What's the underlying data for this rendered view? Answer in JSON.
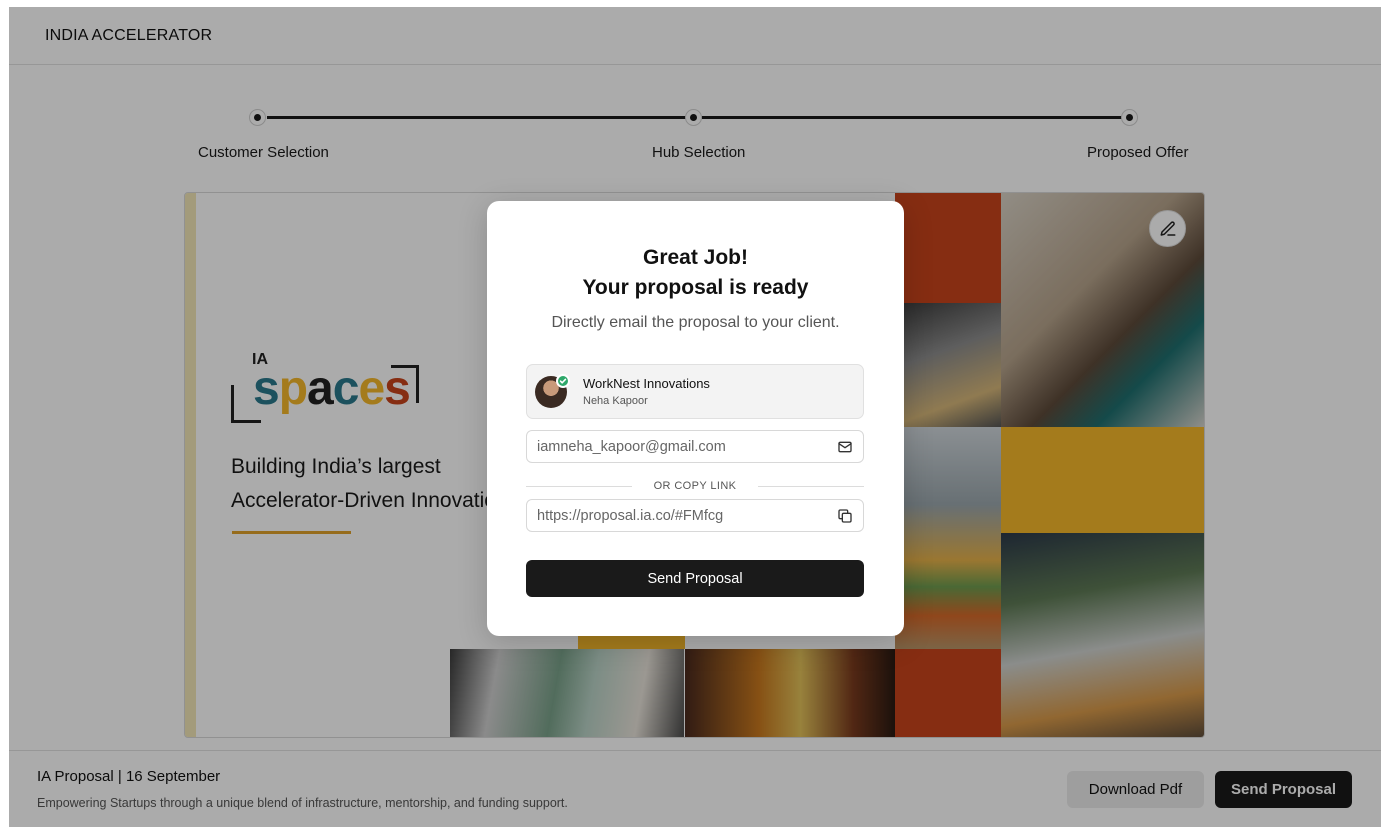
{
  "header": {
    "brand": "INDIA ACCELERATOR"
  },
  "stepper": {
    "steps": [
      {
        "label": "Customer Selection"
      },
      {
        "label": "Hub Selection"
      },
      {
        "label": "Proposed Offer"
      }
    ]
  },
  "preview": {
    "logo_prefix": "IA",
    "logo_word": "spaces",
    "headline_line1": "Building India’s largest",
    "headline_line2": "Accelerator-Driven Innovation"
  },
  "modal": {
    "title_line1": "Great Job!",
    "title_line2": "Your proposal is ready",
    "subtitle": "Directly email the proposal to your client.",
    "client": {
      "company": "WorkNest Innovations",
      "contact": "Neha Kapoor"
    },
    "email_value": "iamneha_kapoor@gmail.com",
    "divider_text": "OR COPY LINK",
    "link_value": "https://proposal.ia.co/#FMfcg",
    "send_label": "Send Proposal"
  },
  "footer": {
    "title": "IA Proposal | 16 September",
    "subtitle": "Empowering Startups through a unique blend of infrastructure, mentorship, and funding support.",
    "download_label": "Download Pdf",
    "send_label": "Send Proposal"
  },
  "colors": {
    "accent_orange": "#c8441c",
    "accent_yellow": "#f5b82a",
    "primary_dark": "#1a1a1a",
    "success_green": "#2ea86a"
  }
}
